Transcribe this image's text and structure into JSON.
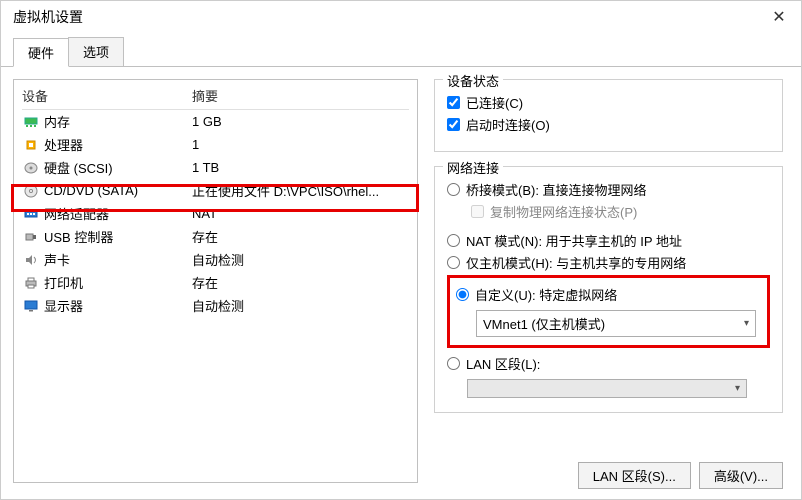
{
  "window": {
    "title": "虚拟机设置"
  },
  "tabs": {
    "hardware": "硬件",
    "options": "选项"
  },
  "columns": {
    "device": "设备",
    "summary": "摘要"
  },
  "devices": [
    {
      "key": "memory",
      "name": "内存",
      "summary": "1 GB"
    },
    {
      "key": "cpu",
      "name": "处理器",
      "summary": "1"
    },
    {
      "key": "hdd",
      "name": "硬盘 (SCSI)",
      "summary": "1 TB"
    },
    {
      "key": "cd",
      "name": "CD/DVD (SATA)",
      "summary": "正在使用文件 D:\\VPC\\ISO\\rhel..."
    },
    {
      "key": "net",
      "name": "网络适配器",
      "summary": "NAT"
    },
    {
      "key": "usb",
      "name": "USB 控制器",
      "summary": "存在"
    },
    {
      "key": "sound",
      "name": "声卡",
      "summary": "自动检测"
    },
    {
      "key": "printer",
      "name": "打印机",
      "summary": "存在"
    },
    {
      "key": "display",
      "name": "显示器",
      "summary": "自动检测"
    }
  ],
  "status": {
    "caption": "设备状态",
    "connected": "已连接(C)",
    "connect_on_start": "启动时连接(O)"
  },
  "netconn": {
    "caption": "网络连接",
    "bridged": "桥接模式(B): 直接连接物理网络",
    "replicate": "复制物理网络连接状态(P)",
    "nat": "NAT 模式(N): 用于共享主机的 IP 地址",
    "hostonly": "仅主机模式(H): 与主机共享的专用网络",
    "custom": "自定义(U): 特定虚拟网络",
    "custom_value": "VMnet1 (仅主机模式)",
    "lanseg": "LAN 区段(L):",
    "lanseg_value": ""
  },
  "buttons": {
    "lanseg": "LAN 区段(S)...",
    "advanced": "高级(V)..."
  }
}
